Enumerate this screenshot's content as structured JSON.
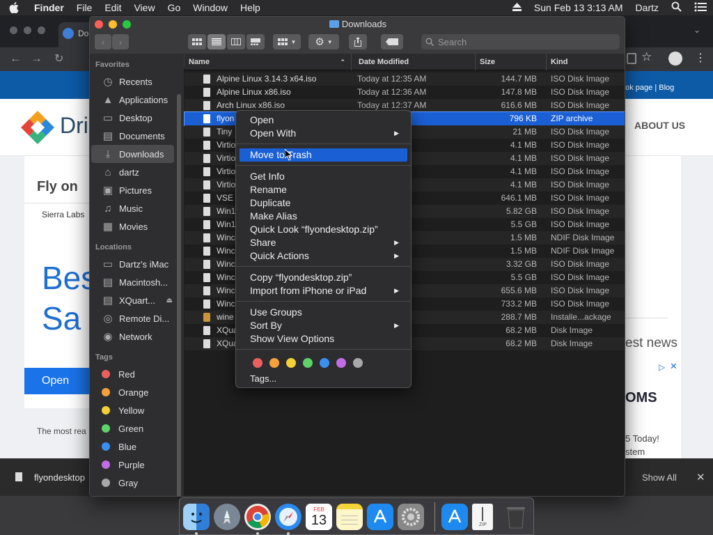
{
  "menubar": {
    "app": "Finder",
    "items": [
      "File",
      "Edit",
      "View",
      "Go",
      "Window",
      "Help"
    ],
    "clock": "Sun Feb 13  3:13 AM",
    "user": "Dartz"
  },
  "browser": {
    "tab_title": "Do",
    "links": "ook page | Blog",
    "nav_about": "ABOUT US",
    "logo_text": "Dri",
    "article_title": "Fly on",
    "byline": "Sierra Labs",
    "hero_line1": "Bes",
    "hero_line2": "Sa",
    "open_button": "Open",
    "footer_text": "The most rea",
    "best_news": "est news",
    "oms": "OMS",
    "today": "5 Today!",
    "system": "stem",
    "download_file": "flyondesktop",
    "show_all": "Show All"
  },
  "finder": {
    "title": "Downloads",
    "search_placeholder": "Search",
    "columns": {
      "name": "Name",
      "date": "Date Modified",
      "size": "Size",
      "kind": "Kind"
    },
    "sidebar": {
      "favorites_label": "Favorites",
      "favorites": [
        {
          "label": "Recents",
          "icon": "clock-icon"
        },
        {
          "label": "Applications",
          "icon": "applications-icon"
        },
        {
          "label": "Desktop",
          "icon": "desktop-icon"
        },
        {
          "label": "Documents",
          "icon": "document-icon"
        },
        {
          "label": "Downloads",
          "icon": "download-icon",
          "selected": true
        },
        {
          "label": "dartz",
          "icon": "home-icon"
        },
        {
          "label": "Pictures",
          "icon": "camera-icon"
        },
        {
          "label": "Music",
          "icon": "music-icon"
        },
        {
          "label": "Movies",
          "icon": "film-icon"
        }
      ],
      "locations_label": "Locations",
      "locations": [
        {
          "label": "Dartz's iMac",
          "icon": "computer-icon"
        },
        {
          "label": "Macintosh...",
          "icon": "disk-icon"
        },
        {
          "label": "XQuart...",
          "icon": "disk-icon"
        },
        {
          "label": "Remote Di...",
          "icon": "disc-icon"
        },
        {
          "label": "Network",
          "icon": "globe-icon"
        }
      ],
      "tags_label": "Tags",
      "tags": [
        {
          "label": "Red",
          "color": "#ec5f5f"
        },
        {
          "label": "Orange",
          "color": "#f5a03a"
        },
        {
          "label": "Yellow",
          "color": "#f3d034"
        },
        {
          "label": "Green",
          "color": "#5dd36a"
        },
        {
          "label": "Blue",
          "color": "#3b8ff0"
        },
        {
          "label": "Purple",
          "color": "#c26de6"
        },
        {
          "label": "Gray",
          "color": "#a8a8a8"
        }
      ]
    },
    "files": [
      {
        "name": "Alpine Linux 3.14.3 x64.iso",
        "date": "Today at 12:35 AM",
        "size": "144.7 MB",
        "kind": "ISO Disk Image"
      },
      {
        "name": "Alpine Linux x86.iso",
        "date": "Today at 12:36 AM",
        "size": "147.8 MB",
        "kind": "ISO Disk Image"
      },
      {
        "name": "Arch Linux x86.iso",
        "date": "Today at 12:37 AM",
        "size": "616.6 MB",
        "kind": "ISO Disk Image"
      },
      {
        "name": "flyon",
        "date": "AM",
        "size": "796 KB",
        "kind": "ZIP archive",
        "selected": true
      },
      {
        "name": "Tiny",
        "date": "3 AM",
        "size": "21 MB",
        "kind": "ISO Disk Image"
      },
      {
        "name": "Virtio",
        "date": "3 AM",
        "size": "4.1 MB",
        "kind": "ISO Disk Image"
      },
      {
        "name": "Virtio",
        "date": "3 AM",
        "size": "4.1 MB",
        "kind": "ISO Disk Image"
      },
      {
        "name": "Virtio",
        "date": "2 AM",
        "size": "4.1 MB",
        "kind": "ISO Disk Image"
      },
      {
        "name": "Virtio",
        "date": "3 AM",
        "size": "4.1 MB",
        "kind": "ISO Disk Image"
      },
      {
        "name": "VSE",
        "date": "9 AM",
        "size": "646.1 MB",
        "kind": "ISO Disk Image"
      },
      {
        "name": "Win1",
        "date": "9 AM",
        "size": "5.82 GB",
        "kind": "ISO Disk Image"
      },
      {
        "name": "Win1",
        "date": "9 AM",
        "size": "5.5 GB",
        "kind": "ISO Disk Image"
      },
      {
        "name": "Winc",
        "date": "9 AM",
        "size": "1.5 MB",
        "kind": "NDIF Disk Image"
      },
      {
        "name": "Winc",
        "date": "AM",
        "size": "1.5 MB",
        "kind": "NDIF Disk Image"
      },
      {
        "name": "Winc",
        "date": "2 AM",
        "size": "3.32 GB",
        "kind": "ISO Disk Image"
      },
      {
        "name": "Winc",
        "date": "9 AM",
        "size": "5.5 GB",
        "kind": "ISO Disk Image"
      },
      {
        "name": "Winc",
        "date": "9 AM",
        "size": "655.6 MB",
        "kind": "ISO Disk Image"
      },
      {
        "name": "Winc",
        "date": "9 AM",
        "size": "733.2 MB",
        "kind": "ISO Disk Image"
      },
      {
        "name": "wine",
        "date": "AM",
        "size": "288.7 MB",
        "kind": "Installe...ackage",
        "icon": "package-icon"
      },
      {
        "name": "XQua",
        "date": "AM",
        "size": "68.2 MB",
        "kind": "Disk Image"
      },
      {
        "name": "XQua",
        "date": "AM",
        "size": "68.2 MB",
        "kind": "Disk Image"
      }
    ]
  },
  "context_menu": {
    "open": "Open",
    "open_with": "Open With",
    "move_to_trash": "Move to Trash",
    "get_info": "Get Info",
    "rename": "Rename",
    "duplicate": "Duplicate",
    "make_alias": "Make Alias",
    "quick_look": "Quick Look “flyondesktop.zip”",
    "share": "Share",
    "quick_actions": "Quick Actions",
    "copy": "Copy “flyondesktop.zip”",
    "import": "Import from iPhone or iPad",
    "use_groups": "Use Groups",
    "sort_by": "Sort By",
    "show_view_options": "Show View Options",
    "tags": "Tags...",
    "tag_colors": [
      "#ec5f5f",
      "#f5a03a",
      "#f3d034",
      "#5dd36a",
      "#3b8ff0",
      "#c26de6",
      "#a8a8a8"
    ]
  },
  "dock": {
    "calendar_month": "FEB",
    "calendar_day": "13",
    "apps": [
      "finder-icon",
      "launchpad-icon",
      "chrome-icon",
      "safari-icon",
      "calendar-icon",
      "notes-icon",
      "app-store-icon",
      "system-preferences-icon",
      "app-store-downloads-icon",
      "zip-file-icon",
      "trash-icon"
    ]
  }
}
